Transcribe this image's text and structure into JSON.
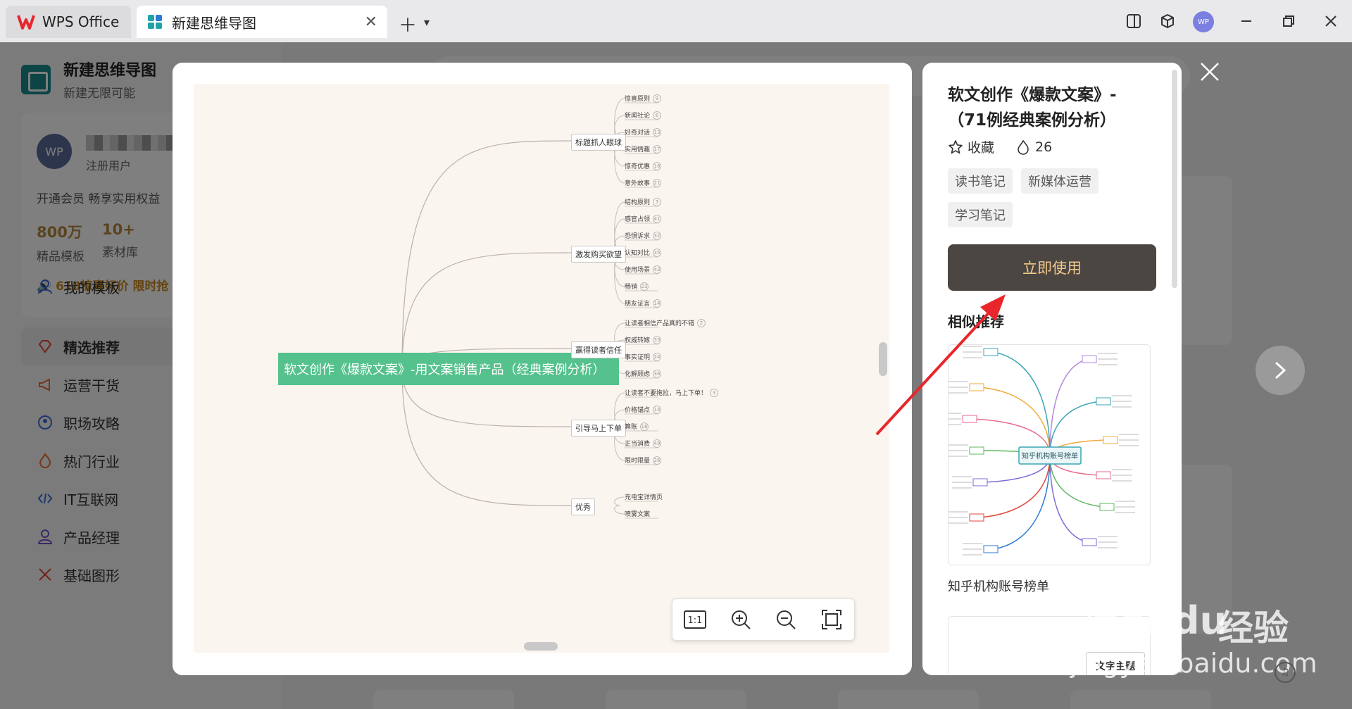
{
  "titlebar": {
    "app_tab": "WPS Office",
    "doc_tab": "新建思维导图",
    "avatar": "WP"
  },
  "sidebar": {
    "brand_title": "新建思维导图",
    "brand_sub": "新建无限可能",
    "user_avatar": "WP",
    "user_role": "注册用户",
    "vip_text": "开通会员 畅享实用权益",
    "stats": [
      {
        "num": "800万",
        "label": "精品模板"
      },
      {
        "num": "10+",
        "label": "素材库"
      }
    ],
    "promo": "618惊喜好价 限时抢",
    "nav_items": [
      {
        "label": "我的模板",
        "icon": "user-icon"
      },
      {
        "label": "精选推荐",
        "icon": "diamond-icon",
        "active": true
      },
      {
        "label": "运营干货",
        "icon": "megaphone-icon"
      },
      {
        "label": "职场攻略",
        "icon": "person-circle-icon"
      },
      {
        "label": "热门行业",
        "icon": "flame-icon"
      },
      {
        "label": "IT互联网",
        "icon": "code-icon"
      },
      {
        "label": "产品经理",
        "icon": "person-icon"
      },
      {
        "label": "基础图形",
        "icon": "shapes-icon"
      }
    ]
  },
  "preview": {
    "root": "软文创作《爆款文案》-用文案销售产品（经典案例分析）",
    "branches": [
      {
        "label": "标题抓人眼球",
        "leaves": [
          [
            "惊喜原则",
            "9"
          ],
          [
            "新闻社论",
            "6"
          ],
          [
            "好奇对话",
            "13"
          ],
          [
            "实用情趣",
            "17"
          ],
          [
            "惊奇优惠",
            "16"
          ],
          [
            "意外故事",
            "21"
          ]
        ]
      },
      {
        "label": "激发购买欲望",
        "leaves": [
          [
            "结构原则",
            "3"
          ],
          [
            "感官占领",
            "41"
          ],
          [
            "恐惧诉求",
            "32"
          ],
          [
            "认知对比",
            "35"
          ],
          [
            "使用场景",
            "43"
          ],
          [
            "畅销",
            "23"
          ],
          [
            "朋友证言",
            "14"
          ]
        ]
      },
      {
        "label": "赢得读者信任",
        "leaves": [
          [
            "让读者相信产品真的不错",
            "2"
          ],
          [
            "权威转嫁",
            "33"
          ],
          [
            "事实证明",
            "24"
          ],
          [
            "化解顾虑",
            "36"
          ]
        ]
      },
      {
        "label": "引导马上下单",
        "leaves": [
          [
            "让读者不要拖拉，马上下单！",
            "3"
          ],
          [
            "价格锚点",
            "14"
          ],
          [
            "算账",
            "18"
          ],
          [
            "正当消费",
            "49"
          ],
          [
            "限时限量",
            "26"
          ]
        ]
      },
      {
        "label": "优秀",
        "leaves": [
          [
            "充电宝详情页",
            ""
          ],
          [
            "喷雾文案",
            ""
          ]
        ]
      }
    ],
    "zoom_buttons": [
      {
        "name": "fit-1to1-button",
        "label": "1:1"
      },
      {
        "name": "zoom-in-button",
        "icon": "zoom-in-icon"
      },
      {
        "name": "zoom-out-button",
        "icon": "zoom-out-icon"
      },
      {
        "name": "fullscreen-button",
        "icon": "fullscreen-icon"
      }
    ]
  },
  "detail": {
    "title": "软文创作《爆款文案》-（71例经典案例分析）",
    "favorite_label": "收藏",
    "heat_count": "26",
    "tags": [
      "读书笔记",
      "新媒体运营",
      "学习笔记"
    ],
    "use_button": "立即使用",
    "similar_title": "相似推荐",
    "similar_center": "知乎机构账号榜单",
    "similar_caption": "知乎机构账号榜单",
    "similar2_label": "文字主题"
  },
  "watermark": {
    "brand": "Bai du",
    "cn": "经验",
    "url": "jingyan.baidu.com"
  },
  "colors": {
    "root_node": "#55c18d",
    "canvas": "#fbf5ef",
    "use_button_bg": "#4b4641",
    "use_button_text": "#f2c98a",
    "annotation_arrow": "#e8262b",
    "promo": "#c98a20"
  }
}
